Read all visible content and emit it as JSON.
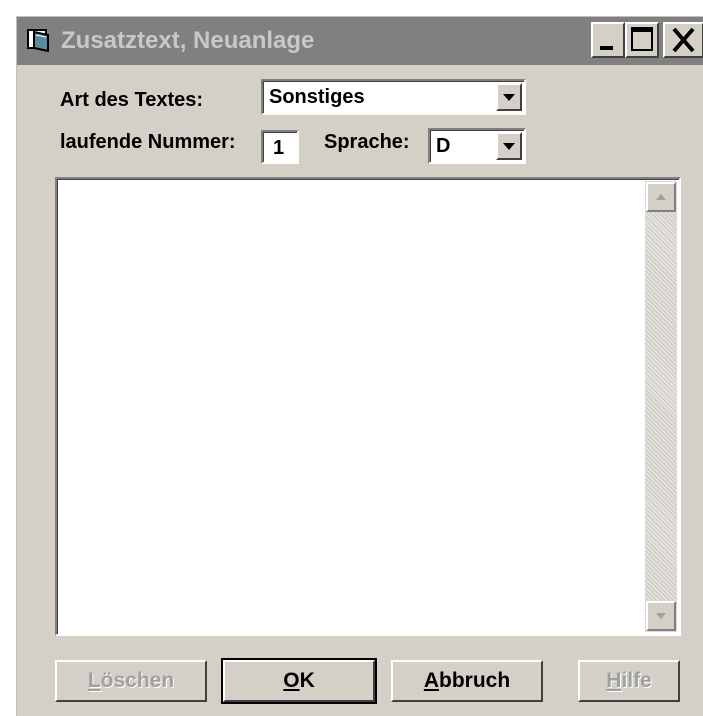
{
  "window": {
    "title": "Zusatztext, Neuanlage"
  },
  "icons": {
    "app": "window-icon",
    "minimize": "minimize-icon",
    "maximize": "maximize-icon",
    "close": "close-icon",
    "dropdown": "dropdown-arrow-icon",
    "scroll_up": "scroll-up-arrow-icon",
    "scroll_down": "scroll-down-arrow-icon"
  },
  "form": {
    "art_label": "Art des Textes:",
    "art_value": "Sonstiges",
    "nummer_label": "laufende Nummer:",
    "nummer_value": "1",
    "sprache_label": "Sprache:",
    "sprache_value": "D"
  },
  "buttons": {
    "loeschen": {
      "label": "Löschen",
      "enabled": false
    },
    "ok": {
      "label": "OK",
      "enabled": true
    },
    "abbruch": {
      "label": "Abbruch",
      "enabled": true
    },
    "hilfe": {
      "label": "Hilfe",
      "enabled": false
    }
  },
  "colors": {
    "face": "#d4d0c8",
    "titlebar_inactive": "#808080",
    "title_text": "#c8c8c8",
    "disabled_text": "#a0a0a0"
  }
}
